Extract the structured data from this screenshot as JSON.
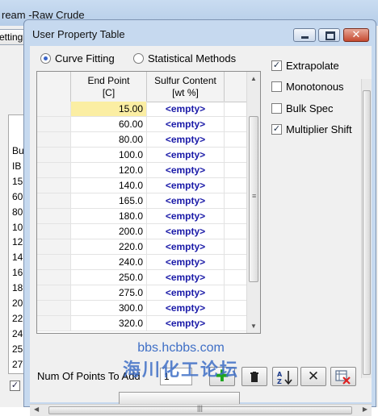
{
  "background_window": {
    "title": "ream -Raw Crude",
    "tab_label": "etting",
    "list_items": [
      "Bu",
      "IB",
      "15",
      "60",
      "80",
      "10",
      "12",
      "14",
      "16",
      "18",
      "20",
      "22",
      "24",
      "25",
      "27"
    ]
  },
  "dialog": {
    "title": "User Property Table",
    "method_options": [
      {
        "label": "Curve Fitting",
        "selected": true
      },
      {
        "label": "Statistical Methods",
        "selected": false
      }
    ],
    "options": [
      {
        "label": "Extrapolate",
        "checked": true
      },
      {
        "label": "Monotonous",
        "checked": false
      },
      {
        "label": "Bulk Spec",
        "checked": false
      },
      {
        "label": "Multiplier Shift",
        "checked": true
      }
    ],
    "table": {
      "columns": [
        {
          "line1": "End Point",
          "line2": "[C]"
        },
        {
          "line1": "Sulfur Content",
          "line2": "[wt %]"
        }
      ],
      "rows": [
        {
          "end_point": "15.00",
          "sulfur": "<empty>"
        },
        {
          "end_point": "60.00",
          "sulfur": "<empty>"
        },
        {
          "end_point": "80.00",
          "sulfur": "<empty>"
        },
        {
          "end_point": "100.0",
          "sulfur": "<empty>"
        },
        {
          "end_point": "120.0",
          "sulfur": "<empty>"
        },
        {
          "end_point": "140.0",
          "sulfur": "<empty>"
        },
        {
          "end_point": "165.0",
          "sulfur": "<empty>"
        },
        {
          "end_point": "180.0",
          "sulfur": "<empty>"
        },
        {
          "end_point": "200.0",
          "sulfur": "<empty>"
        },
        {
          "end_point": "220.0",
          "sulfur": "<empty>"
        },
        {
          "end_point": "240.0",
          "sulfur": "<empty>"
        },
        {
          "end_point": "250.0",
          "sulfur": "<empty>"
        },
        {
          "end_point": "275.0",
          "sulfur": "<empty>"
        },
        {
          "end_point": "300.0",
          "sulfur": "<empty>"
        },
        {
          "end_point": "320.0",
          "sulfur": "<empty>"
        }
      ]
    },
    "num_points_label": "Num Of Points To Add",
    "num_points_value": "1",
    "toolbar": [
      {
        "name": "add-point-button",
        "icon": "plus-icon"
      },
      {
        "name": "delete-point-button",
        "icon": "trash-icon"
      },
      {
        "name": "sort-button",
        "icon": "sort-az-icon"
      },
      {
        "name": "remove-button",
        "icon": "x-icon"
      },
      {
        "name": "clear-table-button",
        "icon": "clear-icon"
      }
    ]
  },
  "watermark": {
    "url": "bbs.hcbbs.com",
    "text": "海川化工论坛"
  },
  "colors": {
    "selected_cell": "#fbeea3",
    "empty_value_text": "#1a1aa8",
    "add_icon": "#1fa51f"
  }
}
